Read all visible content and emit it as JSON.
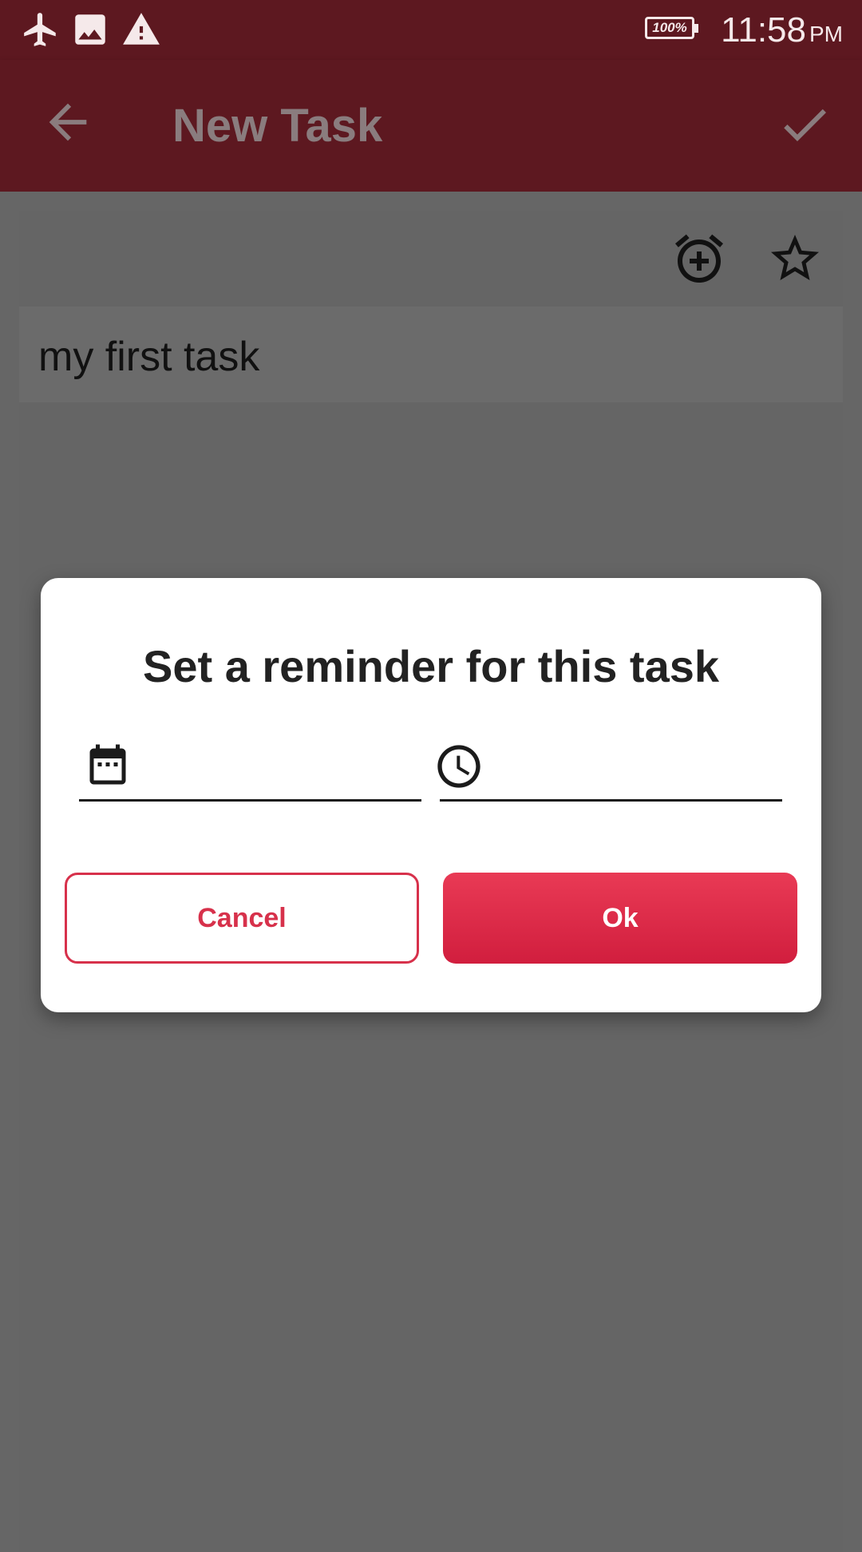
{
  "status_bar": {
    "time": "11:58",
    "ampm": "PM",
    "battery": "100%",
    "icons": [
      "airplane-icon",
      "image-icon",
      "warning-icon"
    ]
  },
  "app_bar": {
    "title": "New Task",
    "back_icon": "arrow-back-icon",
    "confirm_icon": "check-icon"
  },
  "task": {
    "text": "my first task",
    "alarm_icon": "alarm-add-icon",
    "star_icon": "star-outline-icon"
  },
  "dialog": {
    "title": "Set a reminder for this task",
    "date_value": "",
    "time_value": "",
    "cancel_label": "Cancel",
    "ok_label": "Ok"
  },
  "colors": {
    "app_bar": "#5d1820",
    "accent": "#d7314b",
    "scrim_background": "#666666"
  }
}
